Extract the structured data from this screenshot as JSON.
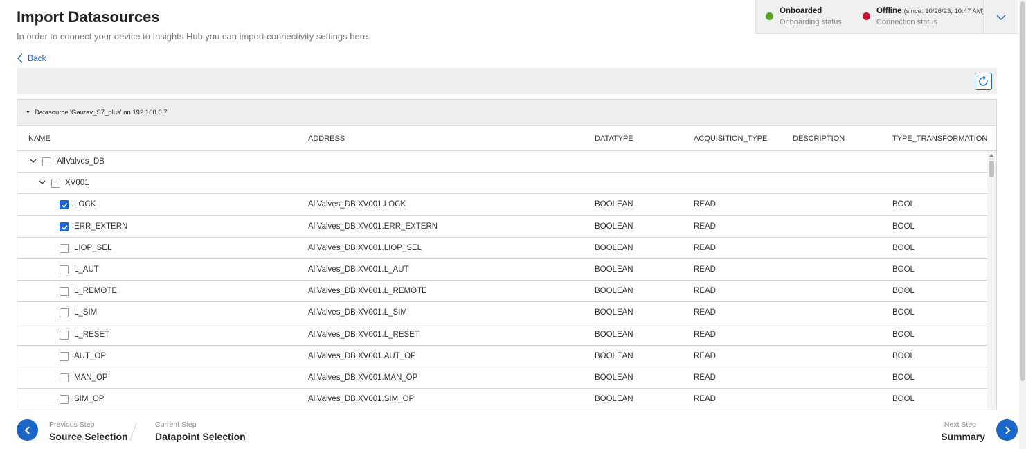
{
  "header": {
    "title": "Import Datasources",
    "subtitle": "In order to connect your device to Insights Hub you can import connectivity settings here.",
    "back_label": "Back"
  },
  "status": {
    "onboard": {
      "label": "Onboarded",
      "sub": "Onboarding status",
      "color": "#5aa427"
    },
    "connection": {
      "label": "Offline",
      "since": "(since: 10/26/23, 10:47 AM)",
      "sub": "Connection status",
      "color": "#c8102e"
    }
  },
  "datasource": {
    "header": "Datasource 'Gaurav_S7_plus' on 192.168.0.7",
    "columns": [
      "NAME",
      "ADDRESS",
      "DATATYPE",
      "ACQUISITION_TYPE",
      "DESCRIPTION",
      "TYPE_TRANSFORMATION"
    ],
    "groups": [
      {
        "name": "AllValves_DB",
        "checked": false,
        "expanded": true
      },
      {
        "name": "XV001",
        "checked": false,
        "expanded": true
      }
    ],
    "rows": [
      {
        "name": "LOCK",
        "address": "AllValves_DB.XV001.LOCK",
        "datatype": "BOOLEAN",
        "acq": "READ",
        "desc": "",
        "trans": "BOOL",
        "checked": true
      },
      {
        "name": "ERR_EXTERN",
        "address": "AllValves_DB.XV001.ERR_EXTERN",
        "datatype": "BOOLEAN",
        "acq": "READ",
        "desc": "",
        "trans": "BOOL",
        "checked": true
      },
      {
        "name": "LIOP_SEL",
        "address": "AllValves_DB.XV001.LIOP_SEL",
        "datatype": "BOOLEAN",
        "acq": "READ",
        "desc": "",
        "trans": "BOOL",
        "checked": false
      },
      {
        "name": "L_AUT",
        "address": "AllValves_DB.XV001.L_AUT",
        "datatype": "BOOLEAN",
        "acq": "READ",
        "desc": "",
        "trans": "BOOL",
        "checked": false
      },
      {
        "name": "L_REMOTE",
        "address": "AllValves_DB.XV001.L_REMOTE",
        "datatype": "BOOLEAN",
        "acq": "READ",
        "desc": "",
        "trans": "BOOL",
        "checked": false
      },
      {
        "name": "L_SIM",
        "address": "AllValves_DB.XV001.L_SIM",
        "datatype": "BOOLEAN",
        "acq": "READ",
        "desc": "",
        "trans": "BOOL",
        "checked": false
      },
      {
        "name": "L_RESET",
        "address": "AllValves_DB.XV001.L_RESET",
        "datatype": "BOOLEAN",
        "acq": "READ",
        "desc": "",
        "trans": "BOOL",
        "checked": false
      },
      {
        "name": "AUT_OP",
        "address": "AllValves_DB.XV001.AUT_OP",
        "datatype": "BOOLEAN",
        "acq": "READ",
        "desc": "",
        "trans": "BOOL",
        "checked": false
      },
      {
        "name": "MAN_OP",
        "address": "AllValves_DB.XV001.MAN_OP",
        "datatype": "BOOLEAN",
        "acq": "READ",
        "desc": "",
        "trans": "BOOL",
        "checked": false
      },
      {
        "name": "SIM_OP",
        "address": "AllValves_DB.XV001.SIM_OP",
        "datatype": "BOOLEAN",
        "acq": "READ",
        "desc": "",
        "trans": "BOOL",
        "checked": false
      }
    ]
  },
  "footer": {
    "prev_label": "Previous Step",
    "prev_name": "Source Selection",
    "current_label": "Current Step",
    "current_name": "Datapoint Selection",
    "next_label": "Next Step",
    "next_name": "Summary"
  }
}
